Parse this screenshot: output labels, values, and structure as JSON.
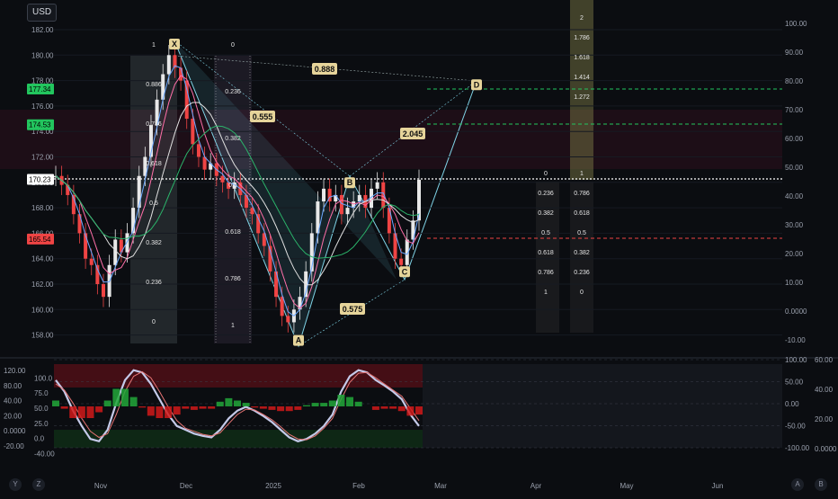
{
  "ui": {
    "currency_button": "USD",
    "bottom_left_buttons": [
      "Y",
      "Z"
    ],
    "bottom_right_buttons": [
      "A",
      "B"
    ]
  },
  "chart_data": [
    {
      "type": "candlestick",
      "yaxis_left": [
        "182.00",
        "180.00",
        "178.00",
        "176.00",
        "174.00",
        "172.00",
        "170.00",
        "168.00",
        "166.00",
        "164.00",
        "162.00",
        "160.00",
        "158.00"
      ],
      "yaxis_left_values": [
        182,
        180,
        178,
        176,
        174,
        172,
        170,
        168,
        166,
        164,
        162,
        160,
        158
      ],
      "yaxis_right": [
        "100.00",
        "90.00",
        "80.00",
        "70.00",
        "60.00",
        "50.00",
        "40.00",
        "30.00",
        "20.00",
        "10.00",
        "0.0000",
        "-10.00"
      ],
      "yaxis_right_values": [
        100,
        90,
        80,
        70,
        60,
        50,
        40,
        30,
        20,
        10,
        0,
        -10
      ],
      "xaxis": [
        "Nov",
        "Dec",
        "2025",
        "Feb",
        "Mar",
        "Apr",
        "May",
        "Jun"
      ],
      "price_tags": [
        {
          "text": "177.34",
          "value": 177.34,
          "color": "#22c55e"
        },
        {
          "text": "174.53",
          "value": 174.53,
          "color": "#22c55e"
        },
        {
          "text": "170.23",
          "value": 170.23,
          "color": "#ffffff"
        },
        {
          "text": "165.54",
          "value": 165.54,
          "color": "#ef4444"
        }
      ],
      "pattern_points": [
        {
          "label": "X",
          "value": 180.8
        },
        {
          "label": "A",
          "value": 157.5
        },
        {
          "label": "B",
          "value": 169.9
        },
        {
          "label": "C",
          "value": 162.9
        },
        {
          "label": "D",
          "value": 177.6
        }
      ],
      "ratios": [
        "0.888",
        "0.555",
        "2.045",
        "0.575"
      ],
      "fib_columns": [
        [
          "1",
          "0.886",
          "0.786",
          "0.618",
          "0.5",
          "0.382",
          "0.236",
          "0"
        ],
        [
          "0",
          "0.236",
          "0.382",
          "0.5",
          "0.618",
          "0.786",
          "1"
        ],
        [
          "0",
          "0.236",
          "0.382",
          "0.5",
          "0.618",
          "0.786",
          "1"
        ],
        [
          "1",
          "0.786",
          "0.618",
          "0.5",
          "0.382",
          "0.236",
          "0"
        ],
        [
          "2",
          "1.786",
          "1.618",
          "1.414",
          "1.272"
        ]
      ],
      "close": [
        170.5,
        169.8,
        169.0,
        167.5,
        166.0,
        164.0,
        163.5,
        162.0,
        161.0,
        163.5,
        165.5,
        164.5,
        166.0,
        168.0,
        170.5,
        172.0,
        174.5,
        176.5,
        178.5,
        180.0,
        179.0,
        178.0,
        175.0,
        173.0,
        172.0,
        171.0,
        171.5,
        170.5,
        170.0,
        169.5,
        170.0,
        169.0,
        168.0,
        167.5,
        166.0,
        165.0,
        163.0,
        161.0,
        159.5,
        159.0,
        160.0,
        161.0,
        163.0,
        166.0,
        168.5,
        169.5,
        168.5,
        169.0,
        167.5,
        168.0,
        168.5,
        169.0,
        168.0,
        169.5,
        170.0,
        168.0,
        166.0,
        164.0,
        163.5,
        165.5,
        167.0,
        170.2
      ]
    },
    {
      "type": "line",
      "yaxis_left": [
        "120.00",
        "100.0",
        "80.00",
        "75.0",
        "40.00",
        "50.0",
        "20.00",
        "25.0",
        "0.0000",
        "0.0",
        "-20.00",
        "-40.00"
      ],
      "yaxis_left_values": [
        120,
        100,
        80,
        75,
        40,
        50,
        20,
        25,
        0,
        0,
        -20,
        -40
      ],
      "yaxis_right_a": [
        "100.00",
        "50.00",
        "0.00",
        "-50.00",
        "-100.00"
      ],
      "yaxis_right_a_values": [
        100,
        50,
        0,
        -50,
        -100
      ],
      "yaxis_right_b": [
        "60.00",
        "40.00",
        "20.00",
        "0.0000"
      ],
      "yaxis_right_b_values": [
        60,
        40,
        20,
        0
      ],
      "series": [
        {
          "values": [
            85,
            70,
            45,
            25,
            8,
            5,
            20,
            55,
            85,
            98,
            95,
            80,
            60,
            40,
            25,
            20,
            15,
            12,
            10,
            20,
            35,
            45,
            50,
            45,
            38,
            30,
            20,
            10,
            5,
            8,
            15,
            25,
            40,
            70,
            90,
            98,
            95,
            85,
            78,
            70,
            60,
            40,
            25
          ]
        },
        {
          "values": [
            80,
            72,
            55,
            35,
            18,
            10,
            15,
            40,
            70,
            90,
            96,
            88,
            70,
            50,
            32,
            22,
            18,
            14,
            12,
            16,
            28,
            40,
            47,
            46,
            40,
            33,
            24,
            14,
            8,
            7,
            12,
            22,
            35,
            60,
            82,
            94,
            95,
            88,
            80,
            72,
            64,
            48,
            32
          ]
        }
      ]
    }
  ]
}
